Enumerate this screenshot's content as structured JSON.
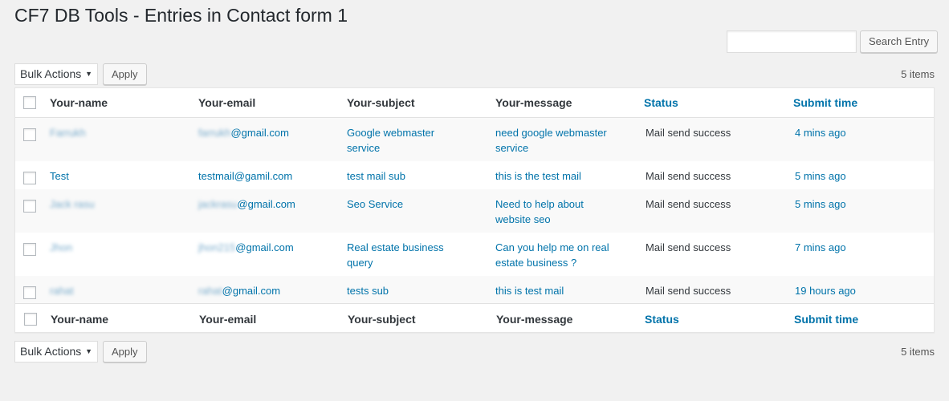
{
  "page": {
    "title": "CF7 DB Tools - Entries in Contact form 1"
  },
  "search": {
    "placeholder": "",
    "button_label": "Search Entry"
  },
  "tablenav": {
    "bulk_label": "Bulk Actions",
    "apply_label": "Apply",
    "items_count": "5 items"
  },
  "columns": {
    "name": "Your-name",
    "email": "Your-email",
    "subject": "Your-subject",
    "message": "Your-message",
    "status": "Status",
    "time": "Submit time"
  },
  "rows": [
    {
      "name": "Farrukh",
      "email_user": "farrukh",
      "email_domain": "@gmail.com",
      "subject": "Google webmaster service",
      "message": "need google webmaster service",
      "status": "Mail send success",
      "time": "4 mins ago"
    },
    {
      "name": "Test",
      "email_user": "testmail",
      "email_domain": "@gamil.com",
      "subject": "test mail sub",
      "message": "this is the test mail",
      "status": "Mail send success",
      "time": "5 mins ago"
    },
    {
      "name": "Jack rasu",
      "email_user": "jackrasu",
      "email_domain": "@gmail.com",
      "subject": "Seo Service",
      "message": "Need to help about website seo",
      "status": "Mail send success",
      "time": "5 mins ago"
    },
    {
      "name": "Jhon",
      "email_user": "jhon215",
      "email_domain": "@gmail.com",
      "subject": "Real estate business query",
      "message": "Can you help me on real estate business ?",
      "status": "Mail send success",
      "time": "7 mins ago"
    },
    {
      "name": "rahat",
      "email_user": "rahat",
      "email_domain": "@gmail.com",
      "subject": "tests sub",
      "message": "this is test mail",
      "status": "Mail send success",
      "time": "19 hours ago"
    }
  ]
}
